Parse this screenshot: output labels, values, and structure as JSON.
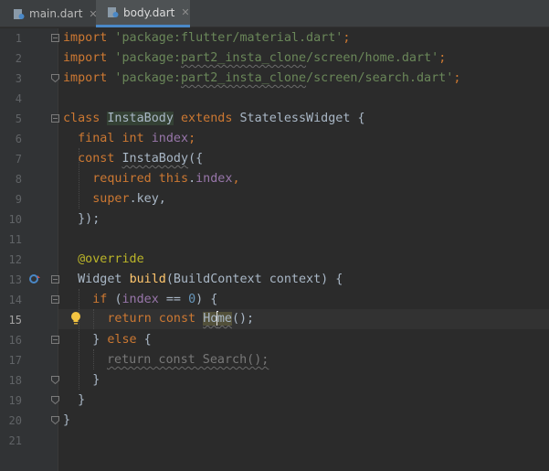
{
  "tabs": [
    {
      "label": "main.dart",
      "active": false,
      "close": "✕"
    },
    {
      "label": "body.dart",
      "active": true,
      "close": "✕"
    }
  ],
  "colors": {
    "keyword": "#cc7832",
    "string": "#6a8759",
    "field": "#9876aa",
    "number": "#6897bb",
    "annotation": "#bbb529"
  },
  "line_numbers": [
    "1",
    "2",
    "3",
    "4",
    "5",
    "6",
    "7",
    "8",
    "9",
    "10",
    "11",
    "12",
    "13",
    "14",
    "15",
    "16",
    "17",
    "18",
    "19",
    "20",
    "21"
  ],
  "current_line": "15",
  "code": {
    "l1": {
      "kw": "import",
      "str": " 'package:flutter/material.dart'",
      "end": ";"
    },
    "l2": {
      "kw": "import",
      "str_a": " 'package:",
      "str_sq": "part2_insta_clone",
      "str_b": "/screen/home.dart'",
      "end": ";"
    },
    "l3": {
      "kw": "import",
      "str_a": " 'package:",
      "str_sq": "part2_insta_clone",
      "str_b": "/screen/search.dart'",
      "end": ";"
    },
    "l5": {
      "kw1": "class ",
      "name": "InstaBody",
      "kw2": " extends ",
      "rest": "StatelessWidget {"
    },
    "l6": {
      "kw": "  final int ",
      "fld": "index",
      "end": ";"
    },
    "l7": {
      "kw": "  const ",
      "name": "InstaBody",
      "end": "({"
    },
    "l8": {
      "kw": "    required this",
      "dot": ".",
      "fld": "index",
      "end": ","
    },
    "l9": {
      "kw": "    super",
      "rest": ".key,"
    },
    "l10": {
      "text": "  });"
    },
    "l12": {
      "ann": "  @override"
    },
    "l13": {
      "a": "  Widget ",
      "b": "build",
      "c": "(BuildContext context) {"
    },
    "l14": {
      "kw": "    if ",
      "a": "(",
      "fld": "index",
      "b": " == ",
      "num": "0",
      "c": ") {"
    },
    "l15": {
      "kw1": "      retur",
      "kw1b": "n",
      "kw2": " const ",
      "name_a": "Ho",
      "name_b": "me",
      "end": "();"
    },
    "l16": {
      "a": "    } ",
      "kw": "else",
      "b": " {"
    },
    "l17": {
      "dim": "return const Search();"
    },
    "l18": {
      "text": "    }"
    },
    "l19": {
      "text": "  }"
    },
    "l20": {
      "text": "}"
    }
  }
}
